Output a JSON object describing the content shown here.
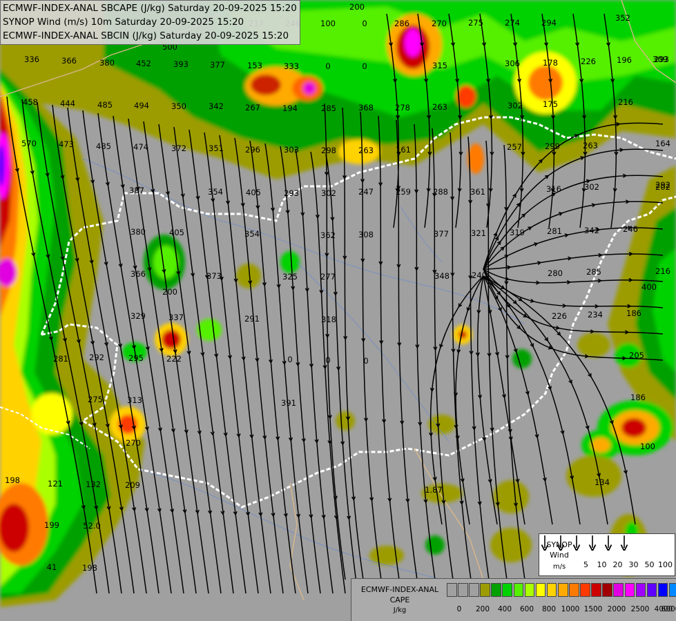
{
  "header": {
    "line1": "ECMWF-INDEX-ANAL SBCAPE (J/kg) Saturday 20-09-2025 15:20",
    "line2": "SYNOP Wind (m/s) 10m Saturday 20-09-2025 15:20",
    "line3": "ECMWF-INDEX-ANAL SBCIN (J/kg) Saturday 20-09-2025 15:20"
  },
  "map_values": [
    "200",
    "246",
    "286",
    "270",
    "275",
    "274",
    "294",
    "352",
    "309",
    "293",
    "217",
    "500",
    "336",
    "366",
    "380",
    "452",
    "393",
    "377",
    "153",
    "333",
    "315",
    "306",
    "178",
    "226",
    "196",
    "458",
    "444",
    "485",
    "494",
    "350",
    "342",
    "267",
    "194",
    "285",
    "368",
    "278",
    "263",
    "302",
    "175",
    "216",
    "570",
    "473",
    "485",
    "474",
    "372",
    "351",
    "296",
    "303",
    "298",
    "263",
    "161",
    "257",
    "299",
    "263",
    "164",
    "387",
    "354",
    "405",
    "293",
    "302",
    "247",
    "259",
    "288",
    "361",
    "316",
    "302",
    "292",
    "202",
    "380",
    "405",
    "354",
    "362",
    "308",
    "377",
    "321",
    "319",
    "281",
    "342",
    "246",
    "366",
    "373",
    "325",
    "277",
    "348",
    "240",
    "280",
    "285",
    "216",
    "200",
    "329",
    "337",
    "291",
    "318",
    "226",
    "234",
    "292",
    "295",
    "222",
    "281",
    "275",
    "313",
    "391",
    "186",
    "270",
    "209",
    "132",
    "121",
    "198",
    "199",
    "52.0",
    "41",
    "198",
    "205",
    "186",
    "134",
    "1.87",
    "100",
    "400",
    "100",
    "0",
    "0",
    "0",
    "0",
    "0",
    "0",
    "0"
  ],
  "wind_legend": {
    "title_line1": "SYNOP",
    "title_line2": "Wind",
    "unit": "m/s",
    "speeds": [
      "5",
      "10",
      "20",
      "30",
      "50",
      "100"
    ]
  },
  "cape_legend": {
    "title_line1": "ECMWF-INDEX-ANAL",
    "title_line2": "CAPE",
    "unit": "J/kg",
    "colors": [
      "#a0a0a0",
      "#a0a0a0",
      "#a0a0a0",
      "#9c9c00",
      "#00a000",
      "#00d200",
      "#55f000",
      "#aaff00",
      "#ffff00",
      "#ffd200",
      "#ffaa00",
      "#ff7a00",
      "#ff3a00",
      "#cc0000",
      "#a00000",
      "#e000e0",
      "#ff00ff",
      "#a000ff",
      "#6000ff",
      "#0000ff",
      "#0088ff",
      "#00ffff",
      "#c0ffff",
      "#ffffff"
    ],
    "labels": [
      "0",
      "200",
      "400",
      "600",
      "800",
      "1000",
      "1500",
      "2000",
      "2500",
      "4000",
      "6000"
    ]
  }
}
